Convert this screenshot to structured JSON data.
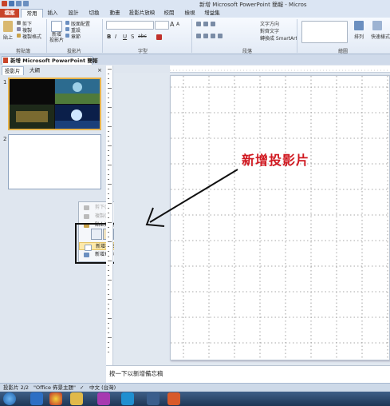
{
  "window": {
    "title": "新增 Microsoft PowerPoint 簡報 - Micros"
  },
  "ribbon_tabs": [
    "檔案",
    "常用",
    "插入",
    "設計",
    "切換",
    "動畫",
    "投影片放映",
    "校閱",
    "檢視",
    "增益集"
  ],
  "ribbon": {
    "clipboard": {
      "paste": "貼上",
      "cut": "剪下",
      "copy": "複製",
      "format_painter": "複製格式",
      "group_label": "剪貼簿"
    },
    "slides": {
      "new_slide": "新增\n投影片",
      "layout": "版面配置",
      "reset": "重設",
      "section": "章節",
      "group_label": "投影片"
    },
    "font": {
      "group_label": "字型",
      "bold": "B",
      "italic": "I",
      "underline": "U",
      "shadow": "S",
      "strike": "abc",
      "grow": "A",
      "shrink": "A"
    },
    "paragraph": {
      "group_label": "段落",
      "text_direction": "文字方向",
      "align_text": "對齊文字",
      "smartart": "轉換成 SmartArt"
    },
    "drawing": {
      "group_label": "繪圖",
      "arrange": "排列",
      "quick_styles": "快速樣式"
    }
  },
  "doc_tab": {
    "label": "新增 Microsoft PowerPoint 簡報"
  },
  "left_pane": {
    "tabs": [
      "投影片",
      "大綱"
    ],
    "slide_numbers": [
      "1",
      "2"
    ]
  },
  "context_menu": {
    "items": [
      {
        "label": "剪下(T)",
        "disabled": true
      },
      {
        "label": "複製(C)",
        "disabled": true
      },
      {
        "label": "貼上選項:",
        "disabled": false
      },
      {
        "label": "新增投影片(N)",
        "disabled": false,
        "highlighted": true
      },
      {
        "label": "新增章節(A)",
        "disabled": false
      }
    ],
    "paste_glyph": "A"
  },
  "annotation": {
    "text": "新增投影片",
    "color": "#d0171f"
  },
  "notes": {
    "placeholder": "按一下以新增備忘稿"
  },
  "status": {
    "slide_count": "投影片 2/2",
    "theme": "\"Office 佈景主題\"",
    "language": "中文 (台灣)"
  },
  "colors": {
    "file_tab": "#c8442a",
    "highlight": "#fde9a8",
    "accent_border": "#e8b34a"
  }
}
